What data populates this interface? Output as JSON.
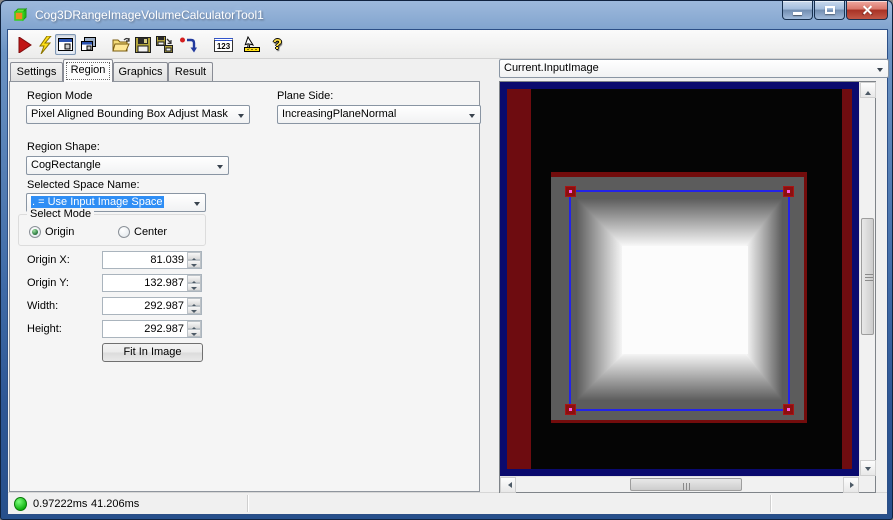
{
  "window": {
    "title": "Cog3DRangeImageVolumeCalculatorTool1"
  },
  "toolbar": {
    "buttons": [
      "run",
      "run-continuous",
      "show-image-display",
      "float-image-display",
      "open",
      "save",
      "save-as",
      "reset",
      "numeric-results",
      "electrode",
      "help"
    ],
    "numeric_icon_text": "123",
    "help_icon_text": "?"
  },
  "tabs": [
    {
      "label": "Settings",
      "active": false
    },
    {
      "label": "Region",
      "active": true
    },
    {
      "label": "Graphics",
      "active": false
    },
    {
      "label": "Result",
      "active": false
    }
  ],
  "region_form": {
    "region_mode": {
      "label": "Region Mode",
      "value": "Pixel Aligned Bounding Box Adjust Mask"
    },
    "plane_side": {
      "label": "Plane Side:",
      "value": "IncreasingPlaneNormal"
    },
    "region_shape": {
      "label": "Region Shape:",
      "value": "CogRectangle"
    },
    "selected_space_name": {
      "label": "Selected Space Name:",
      "value": ". = Use Input Image Space"
    },
    "select_mode": {
      "label": "Select Mode",
      "options": [
        {
          "label": "Origin",
          "selected": true
        },
        {
          "label": "Center",
          "selected": false
        }
      ]
    },
    "origin_x": {
      "label": "Origin X:",
      "value": "81.039"
    },
    "origin_y": {
      "label": "Origin Y:",
      "value": "132.987"
    },
    "width": {
      "label": "Width:",
      "value": "292.987"
    },
    "height": {
      "label": "Height:",
      "value": "292.987"
    },
    "fit_button_label": "Fit In Image"
  },
  "display": {
    "source_selector": "Current.InputImage"
  },
  "status_bar": {
    "time_1": "0.97222ms",
    "time_2": "41.206ms"
  },
  "colors": {
    "status_green": "#17c617",
    "region_outline_blue": "#2323e8",
    "handle_red": "#8c0f0f",
    "handle_dot_magenta": "#ff5ae0",
    "image_border_navy": "#0a0a6e",
    "image_mask_red": "#6e0c10",
    "selection_highlight": "#2f8ef5",
    "titlebar_blue": "#3f6ba7"
  }
}
